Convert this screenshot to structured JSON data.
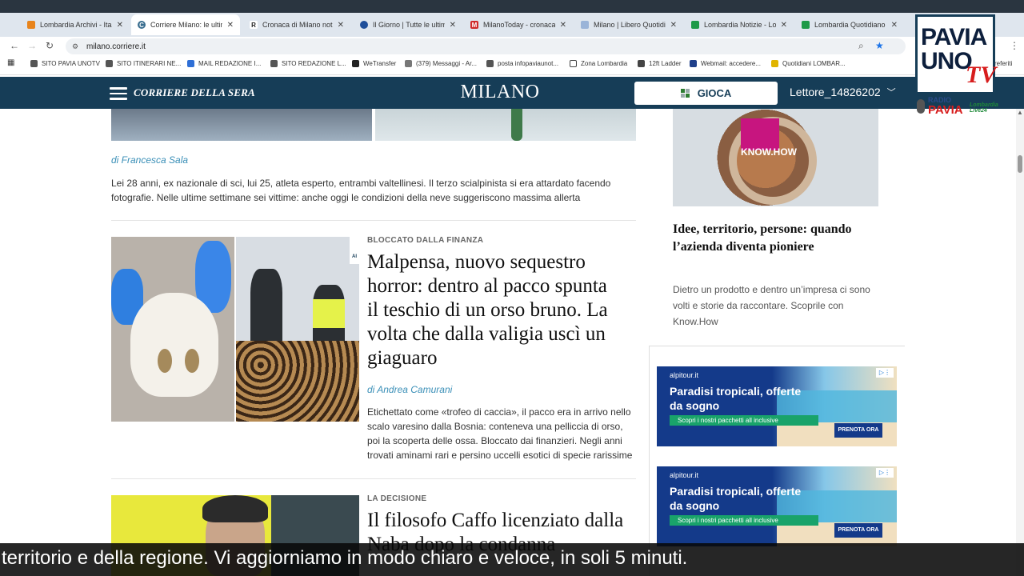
{
  "browser": {
    "tabs": [
      {
        "label": "Lombardia Archivi - Italp",
        "color": "#e8841c",
        "glyph": ""
      },
      {
        "label": "Corriere Milano: le ultime",
        "color": "#3a6e8f",
        "glyph": "C",
        "active": true
      },
      {
        "label": "Cronaca di Milano notizie",
        "color": "#222222",
        "glyph": "R"
      },
      {
        "label": "Il Giorno | Tutte le ultime",
        "color": "#1f4f9a",
        "glyph": ""
      },
      {
        "label": "MilanoToday - cronaca e",
        "color": "#d02a2a",
        "glyph": "M"
      },
      {
        "label": "Milano | Libero Quotidian",
        "color": "#9ab4d8",
        "glyph": ""
      },
      {
        "label": "Lombardia Notizie - Lom",
        "color": "#1e9a48",
        "glyph": ""
      },
      {
        "label": "Lombardia Quotidiano - l",
        "color": "#1e9a48",
        "glyph": ""
      }
    ],
    "url": "milano.corriere.it",
    "bookmarks": [
      {
        "label": "SITO PAVIA UNOTV",
        "color": "#555"
      },
      {
        "label": "SITO ITINERARI NE...",
        "color": "#555"
      },
      {
        "label": "MAIL REDAZIONE I...",
        "color": "#2f6fd6"
      },
      {
        "label": "SITO REDAZIONE L...",
        "color": "#555"
      },
      {
        "label": "WeTransfer",
        "color": "#222"
      },
      {
        "label": "(379) Messaggi - Ar...",
        "color": "#777"
      },
      {
        "label": "posta infopaviaunot...",
        "color": "#555"
      },
      {
        "label": "Zona Lombardia",
        "color": "#444"
      },
      {
        "label": "12ft Ladder",
        "color": "#444"
      },
      {
        "label": "Webmail: accedere...",
        "color": "#1f3f8a"
      },
      {
        "label": "Quotidiani LOMBAR...",
        "color": "#e0b400"
      }
    ],
    "bookmarks_more": "referiti"
  },
  "site": {
    "brand": "CORRIERE DELLA SERA",
    "section": "MILANO",
    "gioca_label": "GIOCA",
    "user_label": "Lettore_14826202"
  },
  "articles": [
    {
      "author": "di Francesca Sala",
      "summary": "Lei 28 anni, ex nazionale di sci, lui 25, atleta esperto, entrambi valtellinesi. Il terzo scialpinista si era attardato facendo fotografie. Nelle ultime settimane sei vittime: anche oggi le condizioni della neve suggeriscono massima allerta"
    },
    {
      "kicker": "BLOCCATO DALLA FINANZA",
      "headline": "Malpensa, nuovo sequestro horror: dentro al pacco spunta il teschio di un orso bruno. La volta che dalla valigia uscì un giaguaro",
      "author": "di Andrea Camurani",
      "summary": "Etichettato come «trofeo di caccia», il pacco era in arrivo nello scalo varesino dalla Bosnia: conteneva una pelliccia di orso, poi la scoperta delle ossa. Bloccato dai finanzieri. Negli anni trovati aminami rari e persino uccelli esotici di specie rarissime",
      "image_badge": "AI"
    },
    {
      "kicker": "LA DECISIONE",
      "headline": "Il filosofo Caffo licenziato dalla Naba dopo la condanna"
    }
  ],
  "sidebar": {
    "sponsor_logo": "KNOW.HOW",
    "sponsor_title": "Idee, territorio, persone: quando l’azienda diventa pioniere",
    "sponsor_text": "Dietro un prodotto e dentro un’impresa ci sono volti e storie da raccontare. Scoprile con Know.How",
    "ads": [
      {
        "brand": "alpitour.it",
        "title": "Paradisi tropicali, offerte da sogno",
        "bar": "Scopri i nostri pacchetti all inclusive",
        "cta": "PRENOTA ORA"
      },
      {
        "brand": "alpitour.it",
        "title": "Paradisi tropicali, offerte da sogno",
        "bar": "Scopri i nostri pacchetti all inclusive",
        "cta": "PRENOTA ORA"
      }
    ]
  },
  "overlay": {
    "caption": "territorio e della regione. Vi aggiorniamo in modo chiaro e veloce, in soli 5 minuti.",
    "logo_line1": "PAVIA",
    "logo_line2": "UNO",
    "logo_tv": "TV",
    "radio_line1": "RADIO",
    "radio_line2": "PAVIA",
    "radio_badge": "Lombardia Live24"
  }
}
